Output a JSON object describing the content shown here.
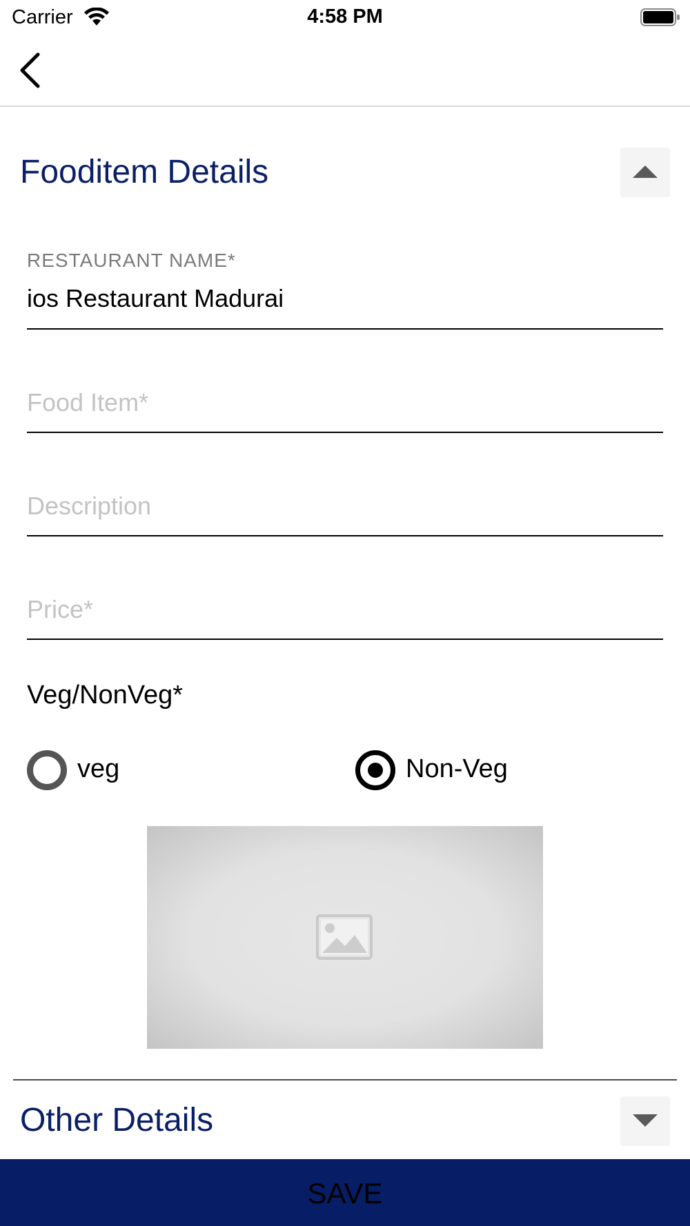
{
  "status_bar": {
    "carrier": "Carrier",
    "time": "4:58 PM"
  },
  "nav": {
    "back_icon": "chevron-left-icon"
  },
  "food_section": {
    "title": "Fooditem Details",
    "toggle_icon": "caret-up-icon",
    "restaurant": {
      "label": "RESTAURANT NAME*",
      "value": "ios Restaurant Madurai"
    },
    "food_item": {
      "placeholder": "Food Item*"
    },
    "description": {
      "placeholder": "Description"
    },
    "price": {
      "placeholder": "Price*"
    },
    "veg_group": {
      "label": "Veg/NonVeg*",
      "options": [
        {
          "label": "veg",
          "selected": false
        },
        {
          "label": "Non-Veg",
          "selected": true
        }
      ]
    },
    "image_icon": "image-icon"
  },
  "other_section": {
    "title": "Other Details",
    "toggle_icon": "caret-down-icon"
  },
  "save": {
    "label": "SAVE"
  },
  "colors": {
    "heading": "#0a1f66",
    "save_bar": "#071d66"
  }
}
